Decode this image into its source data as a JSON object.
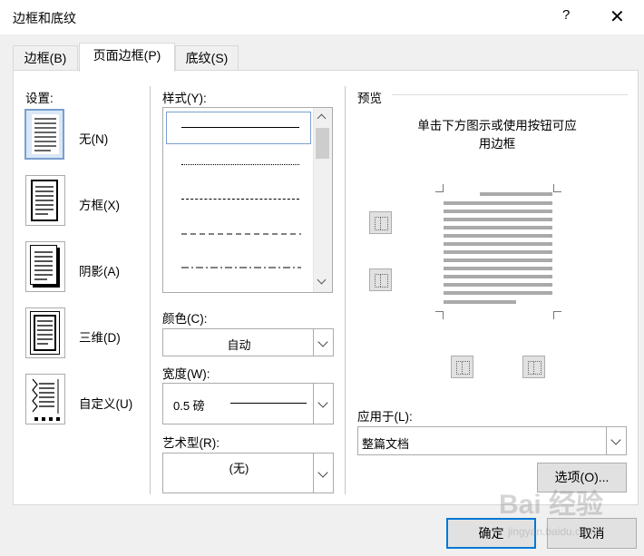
{
  "window": {
    "title": "边框和底纹",
    "help": "?",
    "close": "✕"
  },
  "tabs": [
    {
      "label": "边框(B)",
      "active": false
    },
    {
      "label": "页面边框(P)",
      "active": true
    },
    {
      "label": "底纹(S)",
      "active": false
    }
  ],
  "settings": {
    "heading": "设置:",
    "items": [
      {
        "label": "无(N)",
        "selected": true
      },
      {
        "label": "方框(X)",
        "selected": false
      },
      {
        "label": "阴影(A)",
        "selected": false
      },
      {
        "label": "三维(D)",
        "selected": false
      },
      {
        "label": "自定义(U)",
        "selected": false
      }
    ]
  },
  "style": {
    "heading": "样式(Y):"
  },
  "color": {
    "label": "颜色(C):",
    "value": "自动"
  },
  "width": {
    "label": "宽度(W):",
    "value": "0.5 磅"
  },
  "art": {
    "label": "艺术型(R):",
    "value": "(无)"
  },
  "preview": {
    "heading": "预览",
    "hint_line1": "单击下方图示或使用按钮可应",
    "hint_line2": "用边框"
  },
  "apply_to": {
    "label": "应用于(L):",
    "value": "整篇文档"
  },
  "buttons": {
    "options": "选项(O)...",
    "ok": "确定",
    "cancel": "取消"
  },
  "watermark": {
    "text": "Bai 经验",
    "sub": "jingyan.baidu.com"
  },
  "colors": {
    "accent": "#0078d7",
    "selected_bg": "#d9e7f7"
  }
}
